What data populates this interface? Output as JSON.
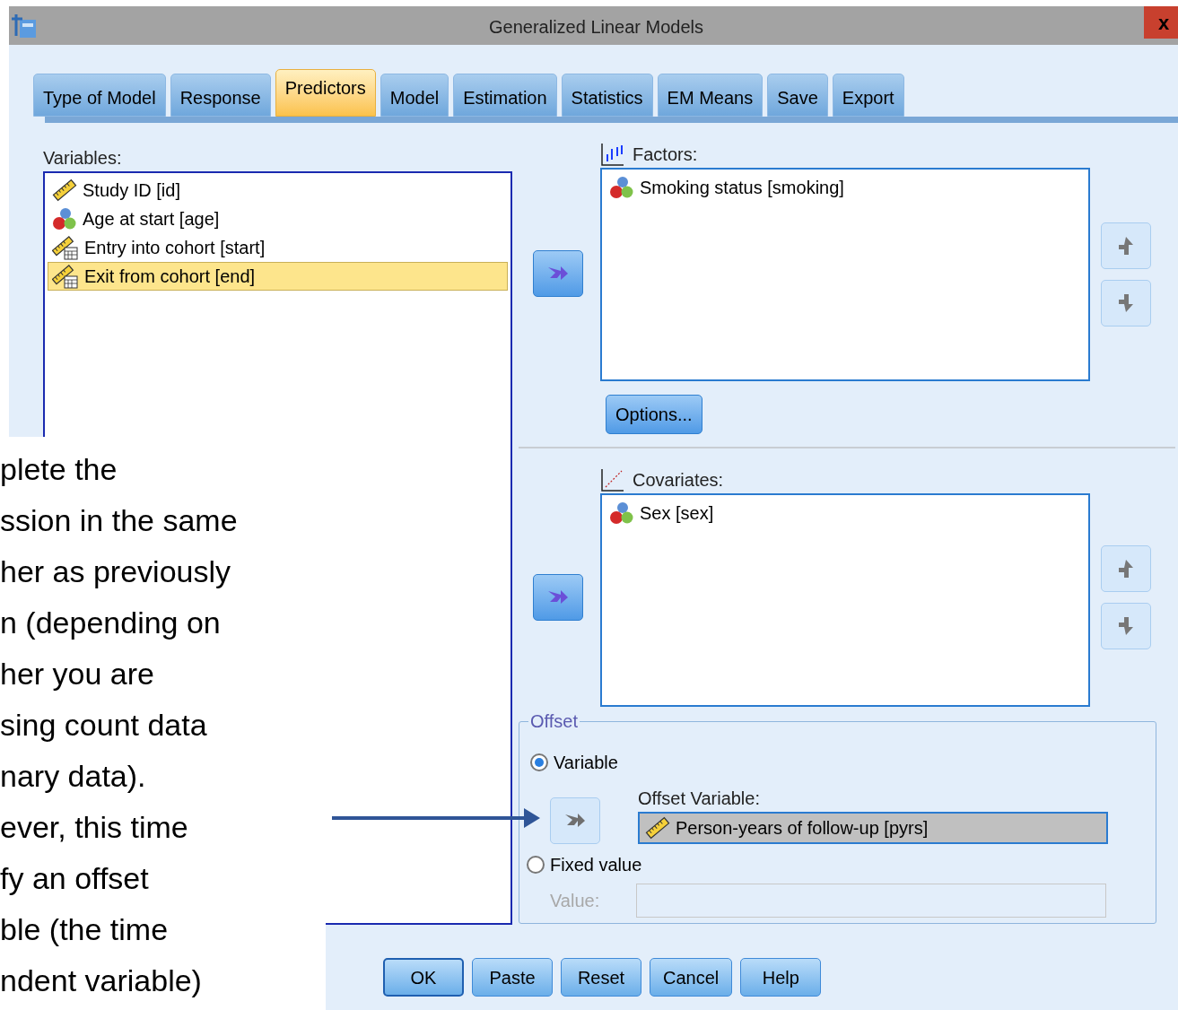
{
  "window": {
    "title": "Generalized Linear Models",
    "close": "x"
  },
  "tabs": [
    {
      "label": "Type of Model",
      "selected": false
    },
    {
      "label": "Response",
      "selected": false
    },
    {
      "label": "Predictors",
      "selected": true
    },
    {
      "label": "Model",
      "selected": false
    },
    {
      "label": "Estimation",
      "selected": false
    },
    {
      "label": "Statistics",
      "selected": false
    },
    {
      "label": "EM Means",
      "selected": false
    },
    {
      "label": "Save",
      "selected": false
    },
    {
      "label": "Export",
      "selected": false
    }
  ],
  "variables": {
    "label": "Variables:",
    "items": [
      {
        "name": "Study ID [id]",
        "kind": "scale",
        "selected": false
      },
      {
        "name": "Age at start [age]",
        "kind": "nominal",
        "selected": false
      },
      {
        "name": "Entry into cohort [start]",
        "kind": "date",
        "selected": false
      },
      {
        "name": "Exit from cohort [end]",
        "kind": "date",
        "selected": true
      }
    ]
  },
  "factors": {
    "label": "Factors:",
    "items": [
      {
        "name": "Smoking status [smoking]",
        "kind": "nominal"
      }
    ],
    "options_button": "Options..."
  },
  "covariates": {
    "label": "Covariates:",
    "items": [
      {
        "name": "Sex [sex]",
        "kind": "nominal"
      }
    ]
  },
  "offset": {
    "title": "Offset",
    "options": [
      {
        "label": "Variable",
        "selected": true
      },
      {
        "label": "Fixed value",
        "selected": false
      }
    ],
    "offset_variable": {
      "label": "Offset Variable:",
      "value": "Person-years of follow-up [pyrs]",
      "kind": "scale"
    },
    "value_field": {
      "label": "Value:",
      "disabled": true
    }
  },
  "buttons": [
    "OK",
    "Paste",
    "Reset",
    "Cancel",
    "Help"
  ],
  "annotation": {
    "lines": [
      "plete the",
      "ssion in the same",
      "her as previously",
      "n (depending on",
      "her you are",
      "sing count data",
      "nary data).",
      "ever, this time",
      "fy an offset",
      "ble (the time",
      "ndent variable)"
    ]
  }
}
